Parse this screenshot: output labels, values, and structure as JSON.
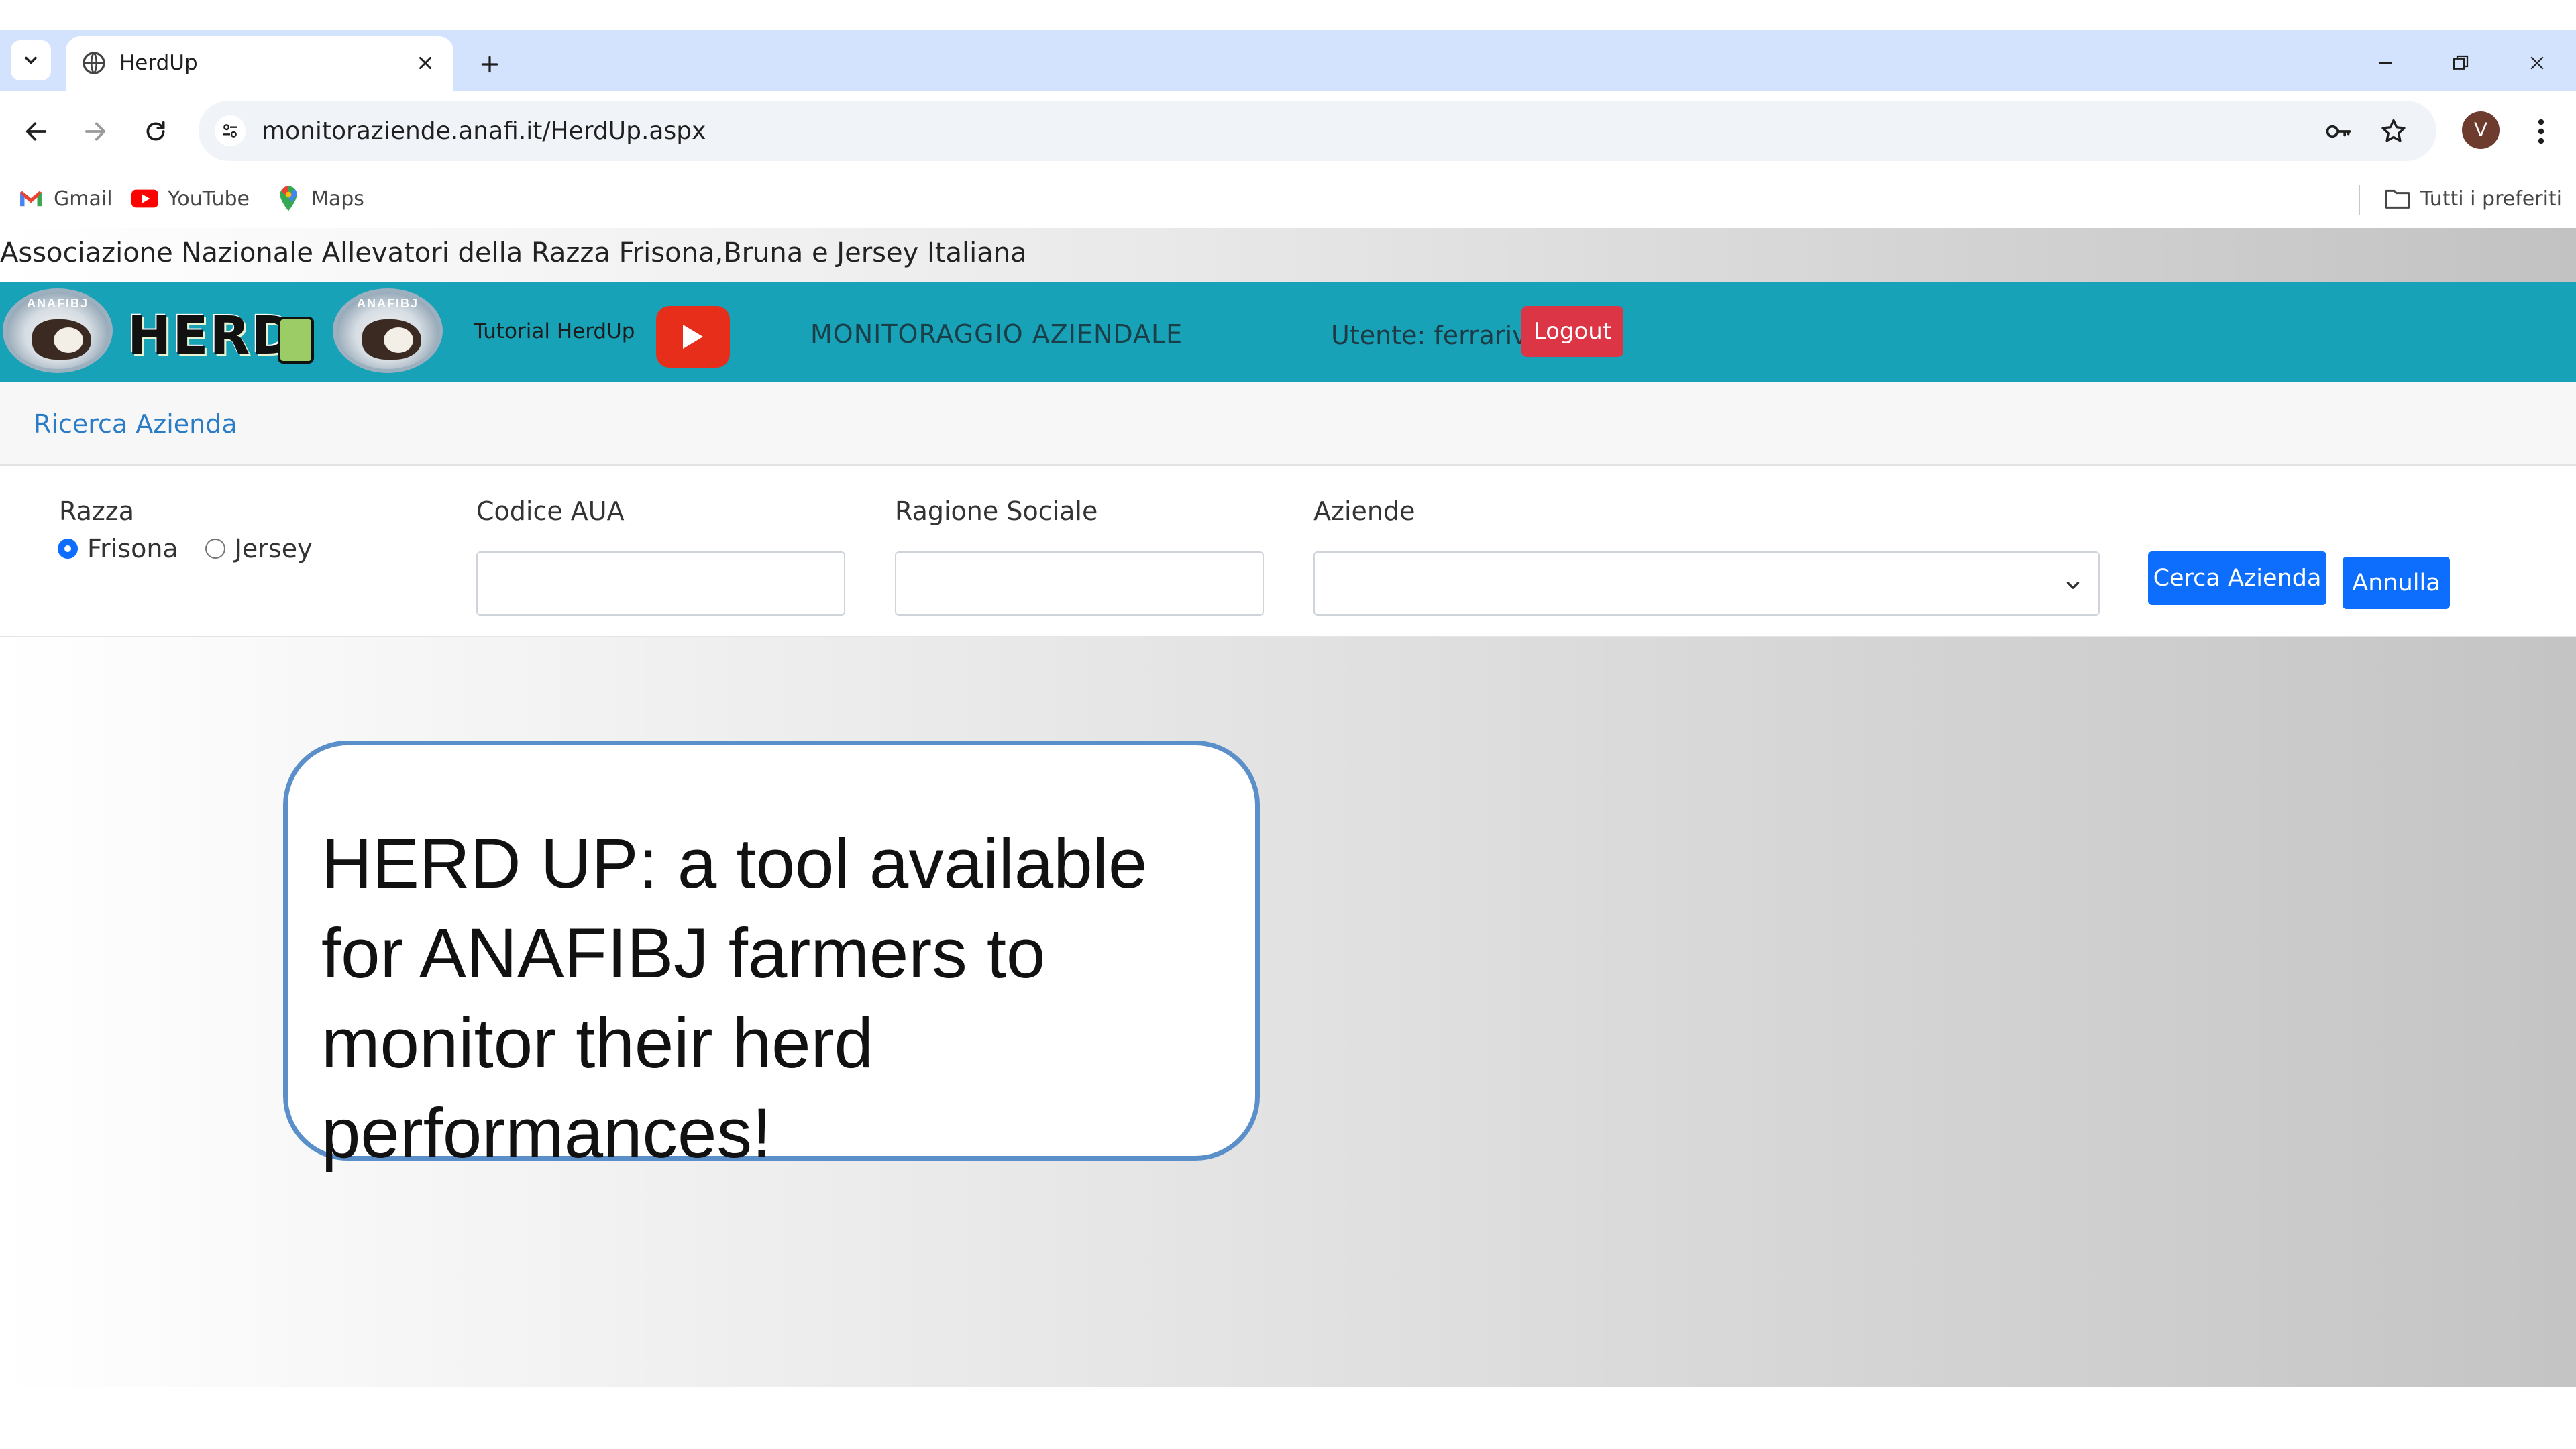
{
  "browser": {
    "tab_title": "HerdUp",
    "url": "monitoraziende.anafi.it/HerdUp.aspx",
    "profile_initial": "V",
    "bookmarks": [
      {
        "label": "Gmail",
        "icon": "gmail-icon"
      },
      {
        "label": "YouTube",
        "icon": "youtube-icon"
      },
      {
        "label": "Maps",
        "icon": "maps-icon"
      }
    ],
    "all_bookmarks_label": "Tutti i preferiti"
  },
  "page": {
    "association": "Associazione Nazionale Allevatori della Razza Frisona,Bruna e Jersey Italiana",
    "logo_band_text": "ANAFIBJ",
    "header": {
      "tutorial_label": "Tutorial HerdUp",
      "monitor_title": "MONITORAGGIO AZIENDALE",
      "user_label": "Utente: ferrariv",
      "logout_label": "Logout"
    },
    "subnav_link": "Ricerca Azienda",
    "form": {
      "breed_label": "Razza",
      "breed_options": [
        "Frisona",
        "Jersey"
      ],
      "breed_selected": "Frisona",
      "aua_label": "Codice AUA",
      "aua_value": "",
      "company_name_label": "Ragione Sociale",
      "company_name_value": "",
      "companies_label": "Aziende",
      "companies_selected": "",
      "search_button": "Cerca Azienda",
      "cancel_button": "Annulla"
    }
  },
  "callout": {
    "text": "HERD UP: a tool available for ANAFIBJ farmers to monitor their herd performances!"
  },
  "colors": {
    "header_bg": "#17a2b8",
    "logout_bg": "#dc3545",
    "primary_btn": "#0d6efd",
    "link": "#2a7cc7",
    "callout_border": "#5b8fc9",
    "youtube_red": "#e62e1a"
  }
}
